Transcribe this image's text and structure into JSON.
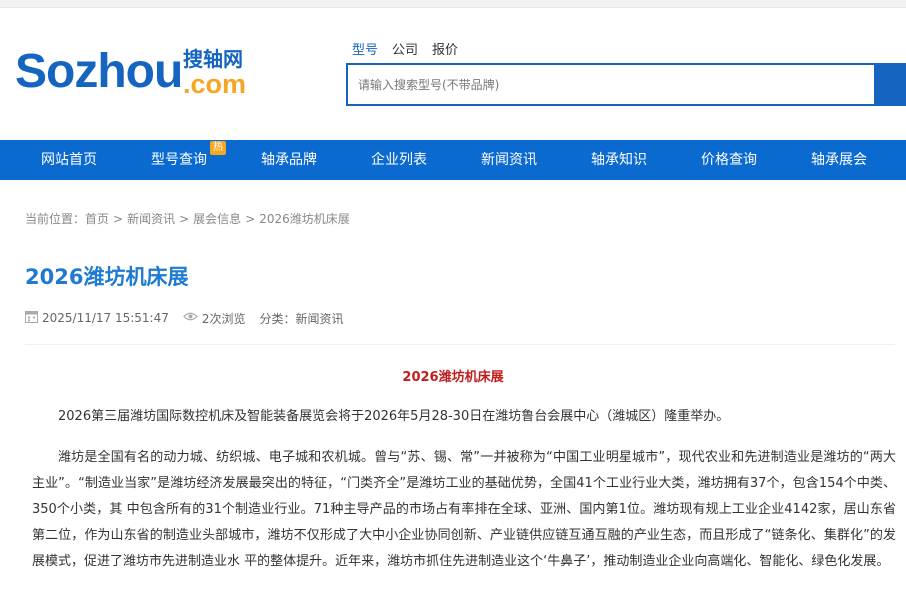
{
  "header": {
    "logo_main": "Sozhou",
    "logo_cn": "搜轴网",
    "logo_dot": ".com",
    "search_tabs": [
      "型号",
      "公司",
      "报价"
    ],
    "search_placeholder": "请输入搜索型号(不带品牌)"
  },
  "nav": {
    "items": [
      "网站首页",
      "型号查询",
      "轴承品牌",
      "企业列表",
      "新闻资讯",
      "轴承知识",
      "价格查询",
      "轴承展会"
    ],
    "hot_badge": "热"
  },
  "breadcrumb": {
    "prefix": "当前位置：",
    "items": [
      "首页",
      "新闻资讯",
      "展会信息",
      "2026潍坊机床展"
    ],
    "separator": ">"
  },
  "article": {
    "page_title": "2026潍坊机床展",
    "datetime": "2025/11/17 15:51:47",
    "views": "2次浏览",
    "category": "分类：新闻资讯",
    "heading": "2026潍坊机床展",
    "paragraphs": [
      "2026第三届潍坊国际数控机床及智能装备展览会将于2026年5月28-30日在潍坊鲁台会展中心（潍城区）隆重举办。",
      "潍坊是全国有名的动力城、纺织城、电子城和农机城。曾与“苏、锡、常”一并被称为“中国工业明星城市”，现代农业和先进制造业是潍坊的“两大主业”。“制造业当家”是潍坊经济发展最突出的特征，“门类齐全”是潍坊工业的基础优势，全国41个工业行业大类，潍坊拥有37个，包含154个中类、350个小类，其 中包含所有的31个制造业行业。71种主导产品的市场占有率排在全球、亚洲、国内第1位。潍坊现有规上工业企业4142家，居山东省第二位，作为山东省的制造业头部城市，潍坊不仅形成了大中小企业协同创新、产业链供应链互通互融的产业生态，而且形成了“链条化、集群化”的发展模式，促进了潍坊市先进制造业水 平的整体提升。近年来，潍坊市抓住先进制造业这个‘牛鼻子’，推动制造业企业向高端化、智能化、绿色化发展。"
    ]
  },
  "colors": {
    "brand_blue": "#1565c0",
    "nav_blue": "#0a6ad0",
    "title_blue": "#1e7bd1",
    "accent_orange": "#f5a623",
    "heading_red": "#c21d1d"
  },
  "icons": [
    "calendar-icon",
    "eye-icon",
    "search-icon"
  ]
}
